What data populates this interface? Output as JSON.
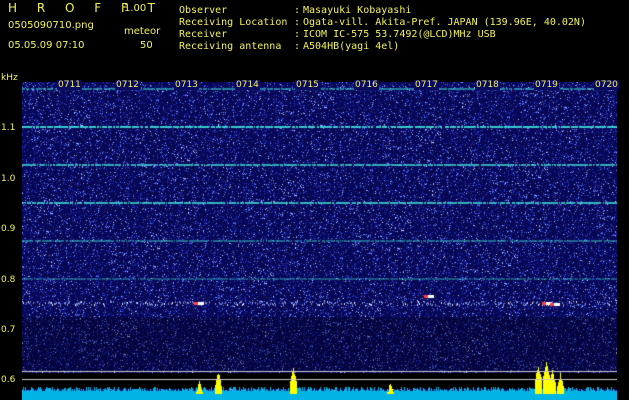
{
  "header": {
    "app_title": "H R O F F T",
    "version": "1.00",
    "filename": "0505090710.png",
    "mode_label": "meteor",
    "datetime": "05.05.09 07:10",
    "count": "50"
  },
  "info": [
    {
      "label": "Observer",
      "sep": ":",
      "value": "Masayuki Kobayashi"
    },
    {
      "label": "Receiving Location",
      "sep": ":",
      "value": "Ogata-vill. Akita-Pref. JAPAN (139.96E, 40.02N)"
    },
    {
      "label": "Receiver",
      "sep": ":",
      "value": "ICOM IC-575 53.7492(@LCD)MHz USB"
    },
    {
      "label": "Receiving antenna",
      "sep": ":",
      "value": "A504HB(yagi 4el)"
    }
  ],
  "axis": {
    "unit": "kHz",
    "freq_labels": [
      "1.1",
      "1.0",
      "0.9",
      "0.8",
      "0.7",
      "0.6"
    ],
    "time_labels": [
      "0711",
      "0712",
      "0713",
      "0714",
      "0715",
      "0716",
      "0717",
      "0718",
      "0719",
      "0720"
    ]
  },
  "colors": {
    "text": "#f2f25a",
    "background": "#000000",
    "noise": "#0a0a78",
    "signal_line": "#3de0d8",
    "echo": "#ffffff",
    "peak": "#ffff00",
    "baseline": "#00b4e6"
  }
}
